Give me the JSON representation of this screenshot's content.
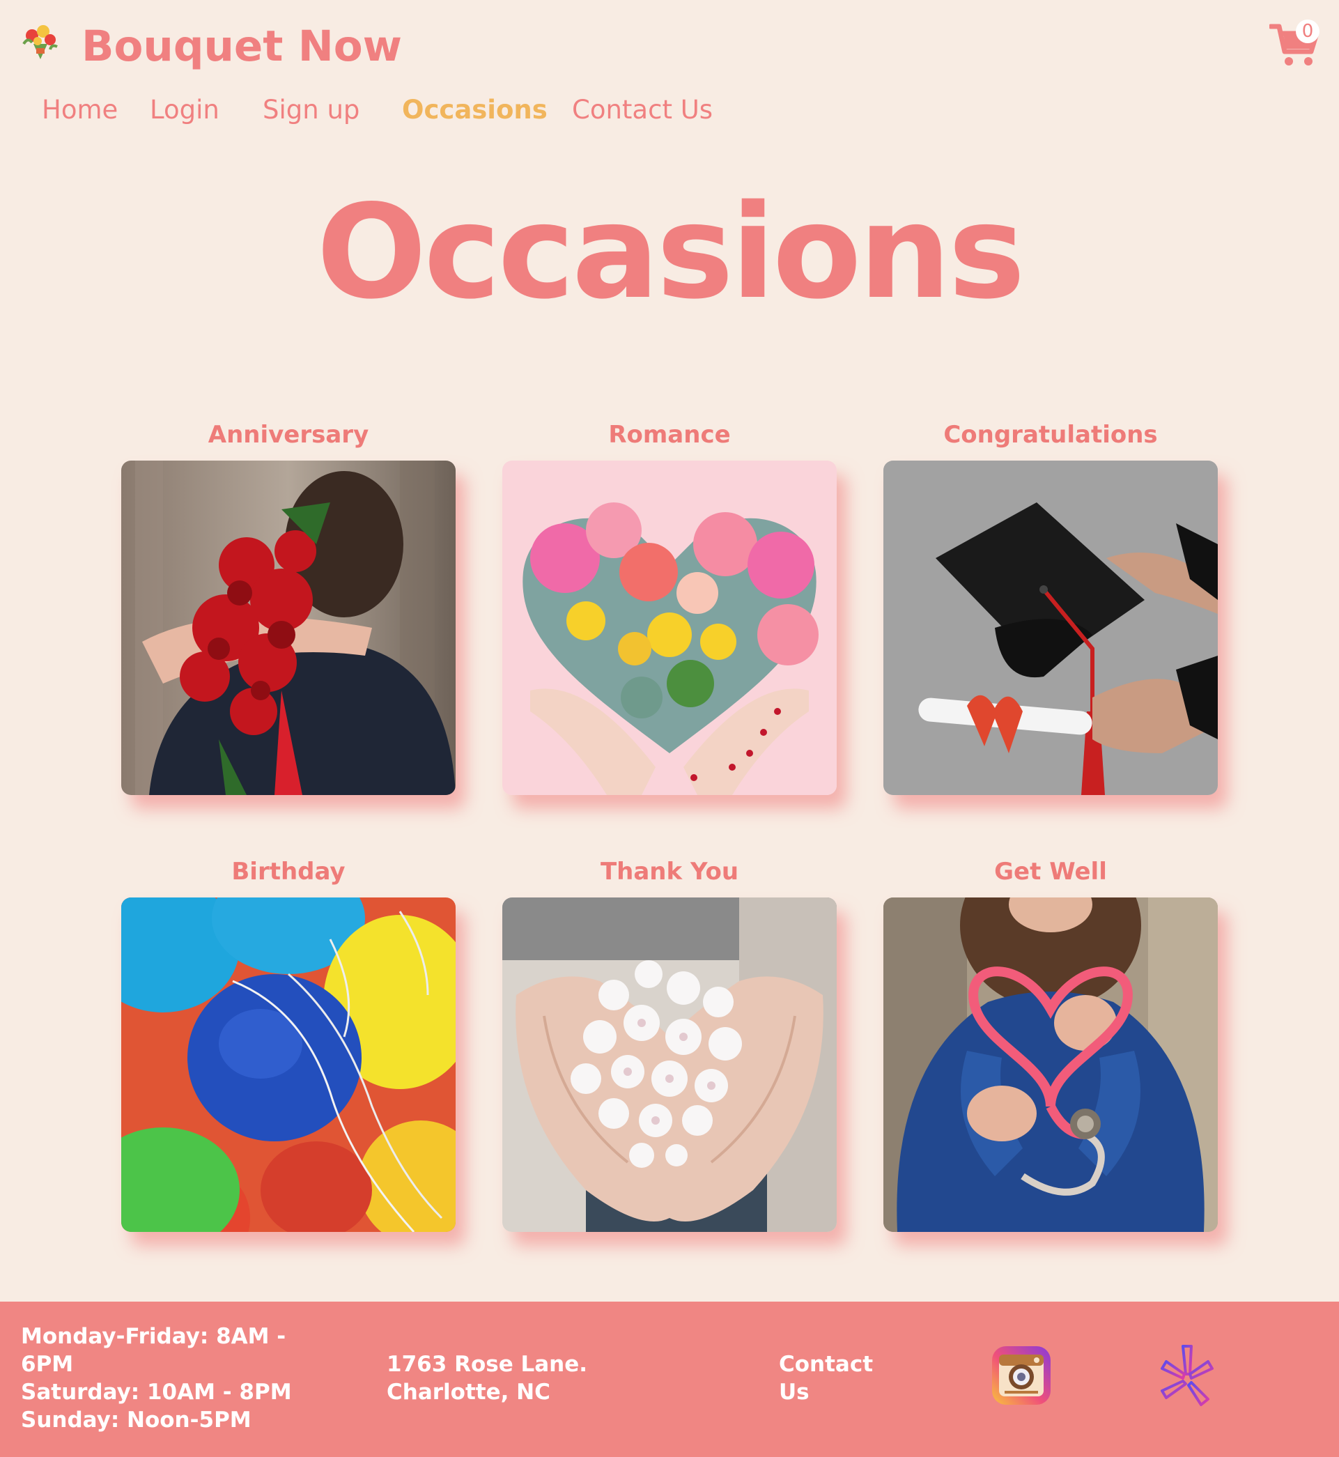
{
  "header": {
    "brand": "Bouquet Now",
    "cart_count": "0"
  },
  "nav": {
    "items": [
      {
        "label": "Home"
      },
      {
        "label": "Login"
      },
      {
        "label": "Sign up"
      },
      {
        "label": "Occasions",
        "active": true
      },
      {
        "label": "Contact Us"
      }
    ]
  },
  "main": {
    "title": "Occasions",
    "occasions": [
      {
        "label": "Anniversary"
      },
      {
        "label": "Romance"
      },
      {
        "label": "Congratulations"
      },
      {
        "label": "Birthday"
      },
      {
        "label": "Thank You"
      },
      {
        "label": "Get Well"
      }
    ]
  },
  "footer": {
    "hours": [
      "Monday-Friday: 8AM - 6PM",
      "Saturday: 10AM - 8PM",
      "Sunday: Noon-5PM"
    ],
    "address": [
      "1763 Rose Lane.",
      "Charlotte, NC"
    ],
    "contact_label": "Contact Us",
    "social": [
      {
        "name": "instagram-icon"
      },
      {
        "name": "yelp-icon"
      }
    ]
  },
  "colors": {
    "background": "#f8ece3",
    "brand": "#f08080",
    "nav_active": "#f1b55c",
    "footer_bg": "#f08683"
  }
}
